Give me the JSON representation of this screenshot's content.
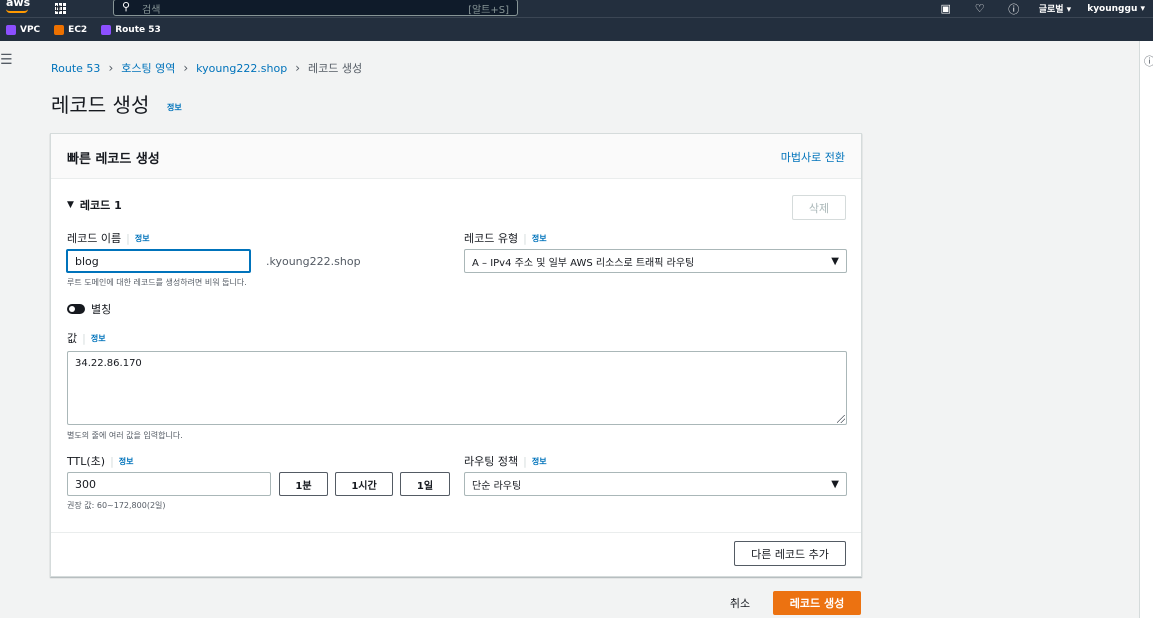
{
  "topnav": {
    "logo": "aws",
    "services_label": "서비스",
    "search_placeholder": "검색",
    "search_shortcut": "[알트+S]",
    "region": "글로벌 ▾",
    "user": "kyounggu ▾",
    "icons": [
      "grid-icon",
      "search-icon",
      "terminal-icon",
      "bell-icon",
      "help-icon"
    ]
  },
  "favorites": [
    {
      "label": "VPC",
      "color": "#8c4fff"
    },
    {
      "label": "EC2",
      "color": "#ed7100"
    },
    {
      "label": "Route 53",
      "color": "#8c4fff"
    }
  ],
  "breadcrumb": {
    "items": [
      "Route 53",
      "호스팅 영역",
      "kyoung222.shop"
    ],
    "current": "레코드 생성"
  },
  "page": {
    "title": "레코드 생성",
    "info": "정보"
  },
  "panel": {
    "title": "빠른 레코드 생성",
    "wizard_link": "마법사로 전환",
    "record_header": "레코드 1",
    "delete_label": "삭제",
    "record_name": {
      "label": "레코드 이름",
      "info": "정보",
      "value": "blog",
      "suffix": ".kyoung222.shop",
      "hint": "루트 도메인에 대한 레코드를 생성하려면 비워 둡니다."
    },
    "record_type": {
      "label": "레코드 유형",
      "info": "정보",
      "value": "A – IPv4 주소 및 일부 AWS 리소스로 트래픽 라우팅"
    },
    "alias_label": "별칭",
    "value": {
      "label": "값",
      "info": "정보",
      "text": "34.22.86.170",
      "hint": "별도의 줄에 여러 값을 입력합니다."
    },
    "ttl": {
      "label": "TTL(초)",
      "info": "정보",
      "value": "300",
      "buttons": [
        "1분",
        "1시간",
        "1일"
      ],
      "hint": "권장 값: 60~172,800(2일)"
    },
    "routing": {
      "label": "라우팅 정책",
      "info": "정보",
      "value": "단순 라우팅"
    },
    "add_record_label": "다른 레코드 추가"
  },
  "actions": {
    "cancel": "취소",
    "create": "레코드 생성"
  },
  "colors": {
    "nav_bg": "#232f3e",
    "link": "#0073bb",
    "primary": "#ec7211"
  }
}
